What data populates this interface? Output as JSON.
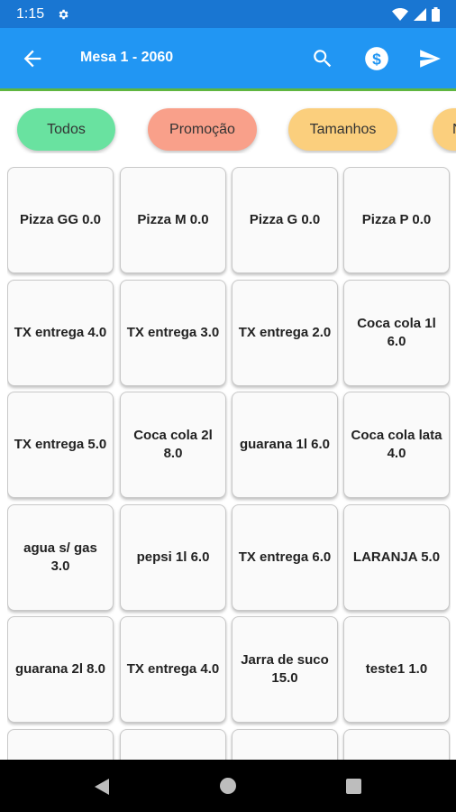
{
  "status_bar": {
    "time": "1:15",
    "icons": [
      "settings-icon",
      "wifi-icon",
      "signal-icon",
      "battery-icon"
    ]
  },
  "app_bar": {
    "title": "Mesa 1 - 2060",
    "actions": [
      "back-arrow-icon",
      "search-icon",
      "dollar-icon",
      "send-icon"
    ],
    "background": "#2196f3"
  },
  "categories": [
    {
      "label": "Todos",
      "color": "#69e2a0"
    },
    {
      "label": "Promoção",
      "color": "#f9a08a"
    },
    {
      "label": "Tamanhos",
      "color": "#fbcf7d"
    },
    {
      "label": "N",
      "color": "#fbcf7d"
    }
  ],
  "products": [
    {
      "label": "Pizza GG 0.0"
    },
    {
      "label": "Pizza M 0.0"
    },
    {
      "label": "Pizza G 0.0"
    },
    {
      "label": "Pizza P 0.0"
    },
    {
      "label": "TX entrega 4.0"
    },
    {
      "label": "TX entrega 3.0"
    },
    {
      "label": "TX entrega 2.0"
    },
    {
      "label": "Coca cola 1l 6.0"
    },
    {
      "label": "TX entrega 5.0"
    },
    {
      "label": "Coca cola 2l 8.0"
    },
    {
      "label": "guarana 1l 6.0"
    },
    {
      "label": "Coca cola lata 4.0"
    },
    {
      "label": "agua s/ gas 3.0"
    },
    {
      "label": "pepsi 1l 6.0"
    },
    {
      "label": "TX entrega 6.0"
    },
    {
      "label": "LARANJA 5.0"
    },
    {
      "label": "guarana 2l 8.0"
    },
    {
      "label": "TX entrega 4.0"
    },
    {
      "label": "Jarra de suco 15.0"
    },
    {
      "label": "teste1 1.0"
    },
    {
      "label": ""
    },
    {
      "label": ""
    },
    {
      "label": ""
    },
    {
      "label": ""
    }
  ],
  "nav_bar": {
    "buttons": [
      "nav-back-icon",
      "nav-home-icon",
      "nav-recents-icon"
    ]
  }
}
